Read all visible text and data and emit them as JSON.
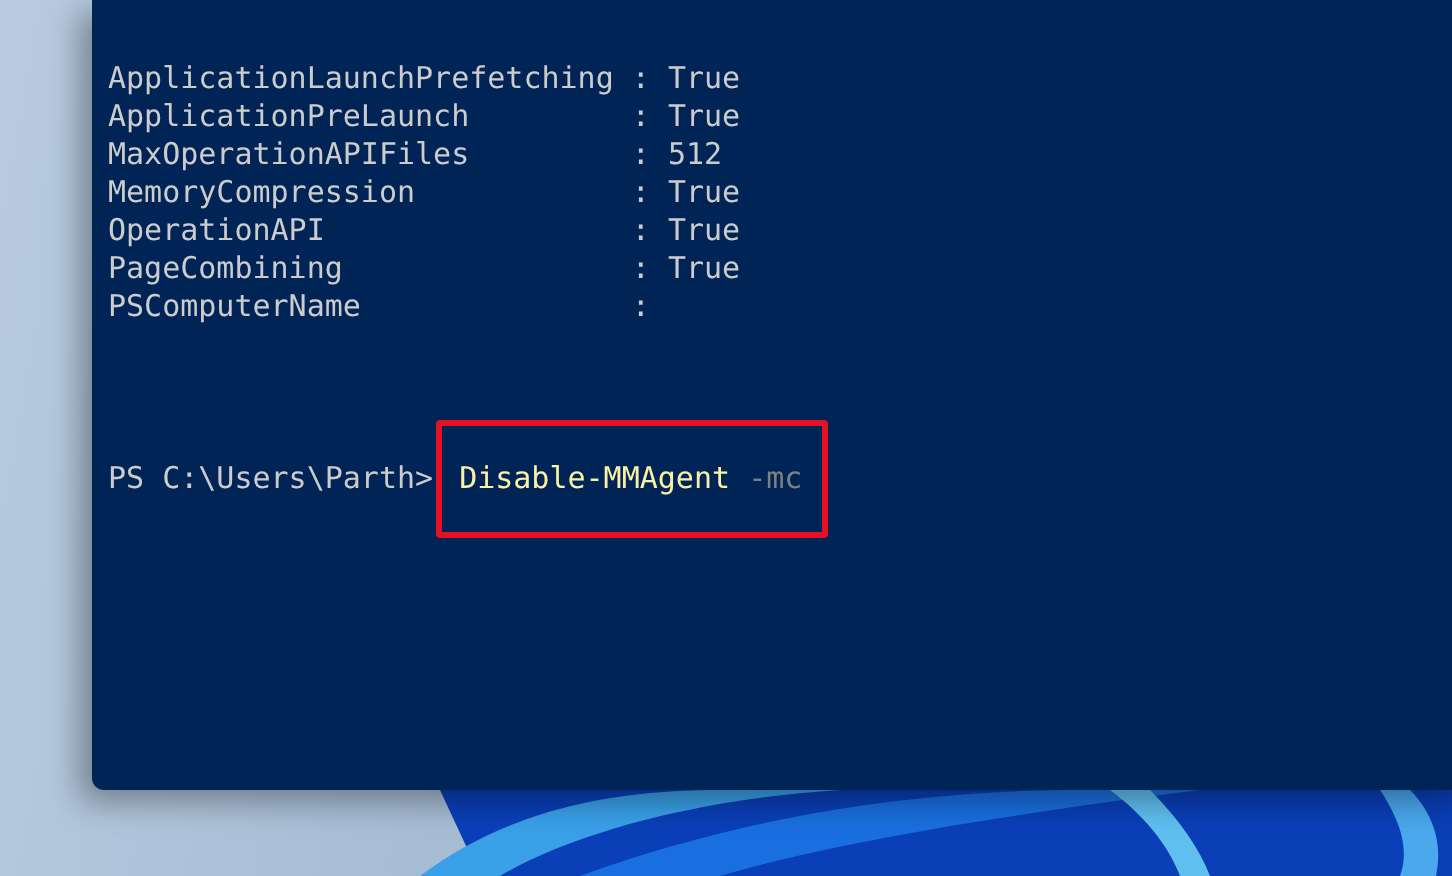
{
  "terminal": {
    "output_lines": [
      {
        "text": "ApplicationLaunchPrefetching : True"
      },
      {
        "text": "ApplicationPreLaunch         : True"
      },
      {
        "text": "MaxOperationAPIFiles         : 512"
      },
      {
        "text": "MemoryCompression            : True"
      },
      {
        "text": "OperationAPI                 : True"
      },
      {
        "text": "PageCombining                : True"
      },
      {
        "text": "PSComputerName               :"
      }
    ],
    "prompt": "PS C:\\Users\\Parth>",
    "command": {
      "name": "Disable-MMAgent",
      "parameter": "-mc",
      "highlighted": true
    }
  }
}
